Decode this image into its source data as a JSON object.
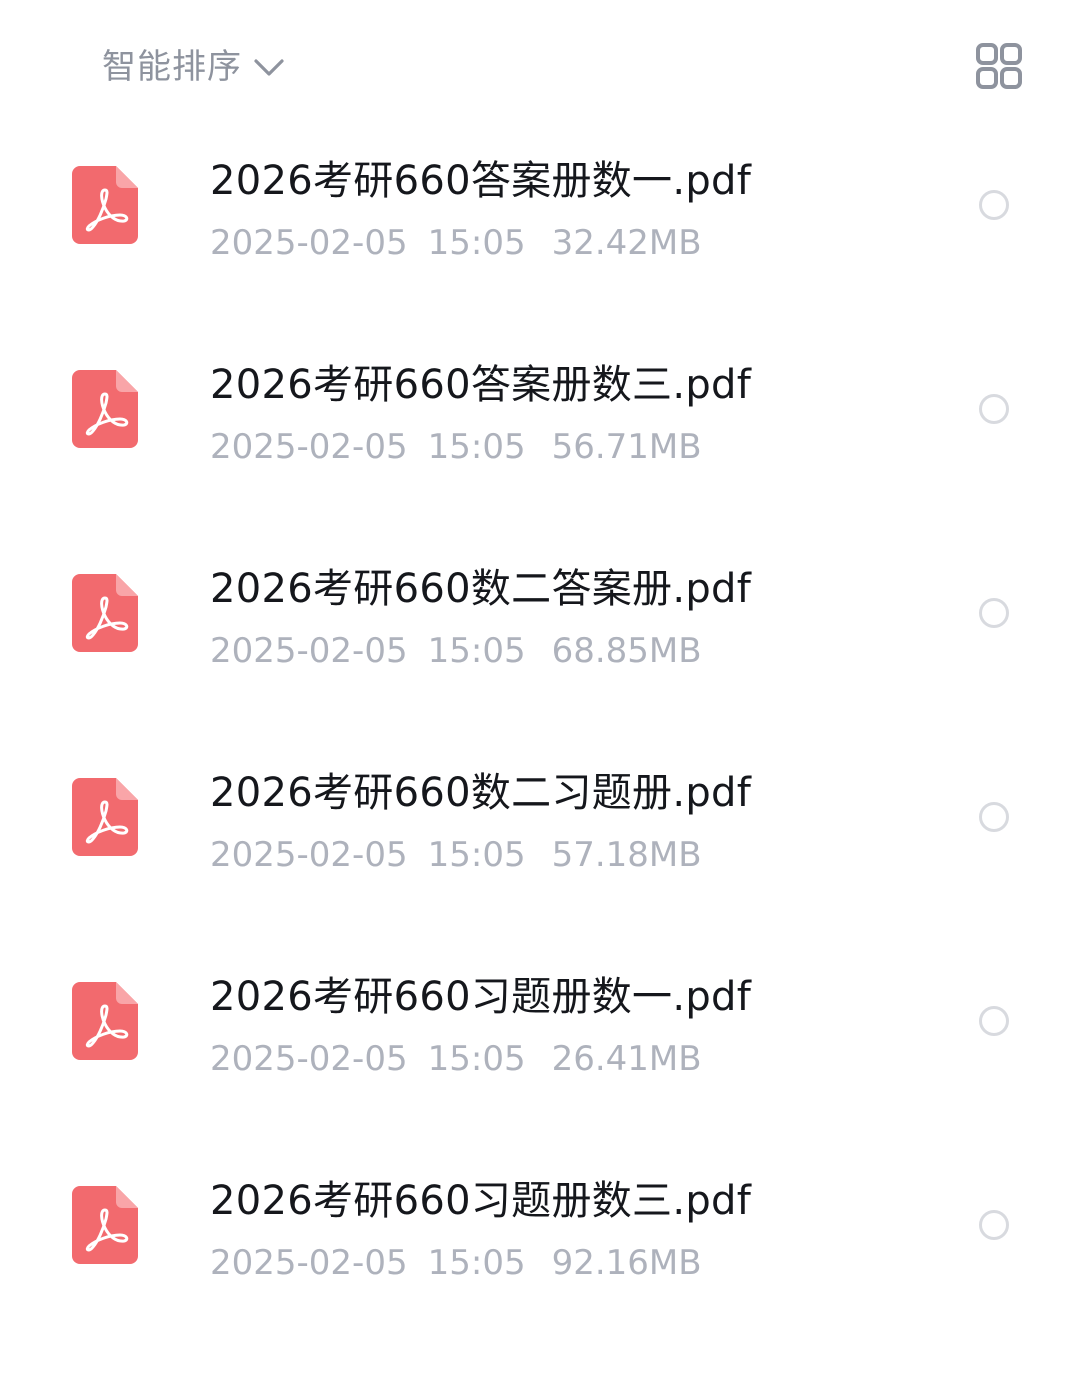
{
  "toolbar": {
    "sort_label": "智能排序",
    "sort_icon": "chevron-down-icon",
    "view_toggle_icon": "grid-view-icon"
  },
  "colors": {
    "pdf_icon": "#f26a6e",
    "text_primary": "#15171c",
    "text_secondary": "#aeb2bc",
    "toolbar_text": "#8e939e",
    "radio_border": "#d8dadf"
  },
  "files": [
    {
      "name": "2026考研660答案册数一.pdf",
      "date": "2025-02-05",
      "time": "15:05",
      "size": "32.42MB",
      "icon": "pdf-file-icon"
    },
    {
      "name": "2026考研660答案册数三.pdf",
      "date": "2025-02-05",
      "time": "15:05",
      "size": "56.71MB",
      "icon": "pdf-file-icon"
    },
    {
      "name": "2026考研660数二答案册.pdf",
      "date": "2025-02-05",
      "time": "15:05",
      "size": "68.85MB",
      "icon": "pdf-file-icon"
    },
    {
      "name": "2026考研660数二习题册.pdf",
      "date": "2025-02-05",
      "time": "15:05",
      "size": "57.18MB",
      "icon": "pdf-file-icon"
    },
    {
      "name": "2026考研660习题册数一.pdf",
      "date": "2025-02-05",
      "time": "15:05",
      "size": "26.41MB",
      "icon": "pdf-file-icon"
    },
    {
      "name": "2026考研660习题册数三.pdf",
      "date": "2025-02-05",
      "time": "15:05",
      "size": "92.16MB",
      "icon": "pdf-file-icon"
    }
  ]
}
